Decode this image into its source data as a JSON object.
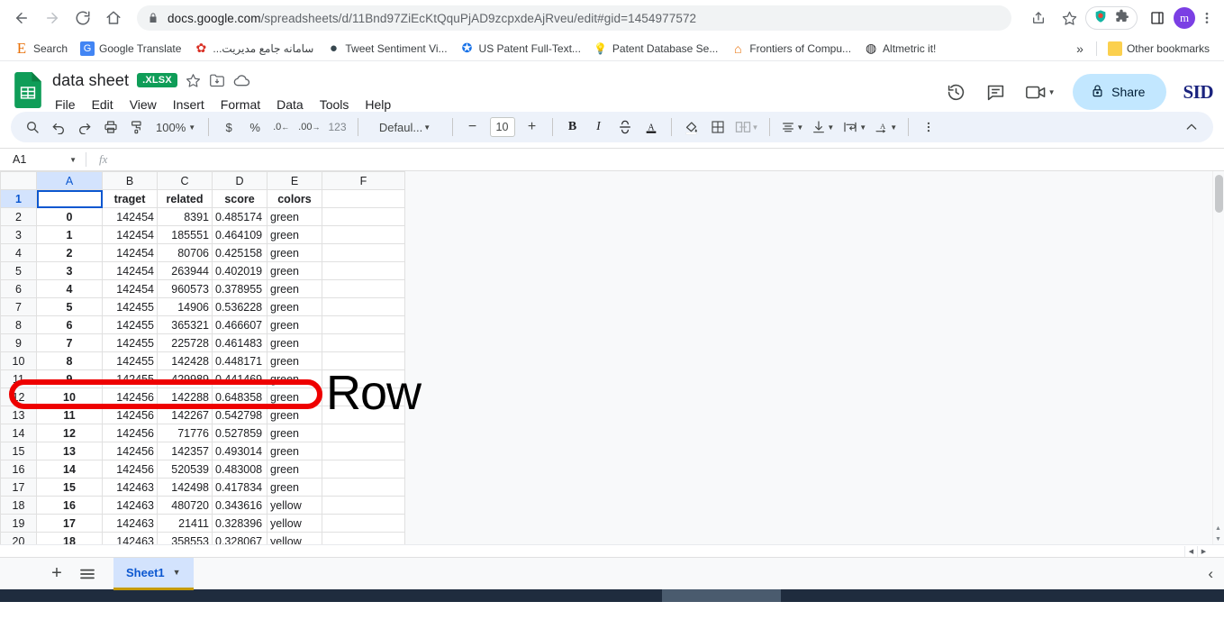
{
  "browser": {
    "nav": {
      "back": "back-arrow",
      "forward": "forward-arrow",
      "reload": "reload",
      "home": "home"
    },
    "url_host": "docs.google.com",
    "url_path": "/spreadsheets/d/11Bnd97ZiEcKtQquPjAD9zcpxdeAjRveu/edit#gid=1454977572",
    "profile_initial": "m",
    "bookmarks": [
      {
        "label": "Search",
        "glyph": "E",
        "color": "#e8710a"
      },
      {
        "label": "Google Translate",
        "glyph": "G",
        "color": "#4285f4"
      },
      {
        "label": "سامانه جامع مدیریت...",
        "glyph": "✿",
        "color": "#d93025"
      },
      {
        "label": "Tweet Sentiment Vi...",
        "glyph": "●",
        "color": "#37474f"
      },
      {
        "label": "US Patent Full-Text...",
        "glyph": "✪",
        "color": "#1a73e8"
      },
      {
        "label": "Patent Database Se...",
        "glyph": "💡",
        "color": "#fbbc04"
      },
      {
        "label": "Frontiers of Compu...",
        "glyph": "⌂",
        "color": "#e8710a"
      },
      {
        "label": "Altmetric it!",
        "glyph": "◍",
        "color": "#202124"
      }
    ],
    "overflow_label": "»",
    "other_bookmarks": "Other bookmarks"
  },
  "app": {
    "doc_title": "data sheet",
    "file_type_badge": ".XLSX",
    "menus": [
      "File",
      "Edit",
      "View",
      "Insert",
      "Format",
      "Data",
      "Tools",
      "Help"
    ],
    "share_label": "Share",
    "brand_right": "SID",
    "header_icons": [
      "star-icon",
      "move-to-folder-icon",
      "cloud-saved-icon",
      "version-history-icon",
      "comment-icon",
      "meet-icon"
    ]
  },
  "toolbar": {
    "zoom": "100%",
    "font_name": "Defaul...",
    "font_size": "10",
    "bold": "B",
    "italic": "I",
    "number_format": "123",
    "currency": "$",
    "percent": "%",
    "decrease_decimal": ".0",
    "increase_decimal": ".00",
    "more_label": "⋮"
  },
  "formula_bar": {
    "name_box": "A1",
    "fx_label": "fx",
    "formula_value": ""
  },
  "annotation": {
    "text": "Row",
    "highlight_color": "#ee0000"
  },
  "grid": {
    "column_headers": [
      "A",
      "B",
      "C",
      "D",
      "E",
      "F"
    ],
    "selected_column": "A",
    "selected_row": "1",
    "active_cell": "A1",
    "header_row": {
      "row_number": "1",
      "cells": [
        "",
        "traget",
        "related",
        "score",
        "colors",
        ""
      ]
    },
    "rows": [
      {
        "n": "2",
        "a": "0",
        "b": "142454",
        "c": "8391",
        "d": "0.485174",
        "e": "green"
      },
      {
        "n": "3",
        "a": "1",
        "b": "142454",
        "c": "185551",
        "d": "0.464109",
        "e": "green"
      },
      {
        "n": "4",
        "a": "2",
        "b": "142454",
        "c": "80706",
        "d": "0.425158",
        "e": "green"
      },
      {
        "n": "5",
        "a": "3",
        "b": "142454",
        "c": "263944",
        "d": "0.402019",
        "e": "green"
      },
      {
        "n": "6",
        "a": "4",
        "b": "142454",
        "c": "960573",
        "d": "0.378955",
        "e": "green"
      },
      {
        "n": "7",
        "a": "5",
        "b": "142455",
        "c": "14906",
        "d": "0.536228",
        "e": "green"
      },
      {
        "n": "8",
        "a": "6",
        "b": "142455",
        "c": "365321",
        "d": "0.466607",
        "e": "green"
      },
      {
        "n": "9",
        "a": "7",
        "b": "142455",
        "c": "225728",
        "d": "0.461483",
        "e": "green"
      },
      {
        "n": "10",
        "a": "8",
        "b": "142455",
        "c": "142428",
        "d": "0.448171",
        "e": "green"
      },
      {
        "n": "11",
        "a": "9",
        "b": "142455",
        "c": "429989",
        "d": "0.441469",
        "e": "green"
      },
      {
        "n": "12",
        "a": "10",
        "b": "142456",
        "c": "142288",
        "d": "0.648358",
        "e": "green"
      },
      {
        "n": "13",
        "a": "11",
        "b": "142456",
        "c": "142267",
        "d": "0.542798",
        "e": "green"
      },
      {
        "n": "14",
        "a": "12",
        "b": "142456",
        "c": "71776",
        "d": "0.527859",
        "e": "green"
      },
      {
        "n": "15",
        "a": "13",
        "b": "142456",
        "c": "142357",
        "d": "0.493014",
        "e": "green"
      },
      {
        "n": "16",
        "a": "14",
        "b": "142456",
        "c": "520539",
        "d": "0.483008",
        "e": "green"
      },
      {
        "n": "17",
        "a": "15",
        "b": "142463",
        "c": "142498",
        "d": "0.417834",
        "e": "green"
      },
      {
        "n": "18",
        "a": "16",
        "b": "142463",
        "c": "480720",
        "d": "0.343616",
        "e": "yellow"
      },
      {
        "n": "19",
        "a": "17",
        "b": "142463",
        "c": "21411",
        "d": "0.328396",
        "e": "yellow"
      },
      {
        "n": "20",
        "a": "18",
        "b": "142463",
        "c": "358553",
        "d": "0.328067",
        "e": "yellow"
      }
    ]
  },
  "sheet_bar": {
    "add_label": "+",
    "all_sheets_label": "≡",
    "tabs": [
      {
        "name": "Sheet1",
        "active": true
      }
    ],
    "collapse_label": "‹"
  }
}
